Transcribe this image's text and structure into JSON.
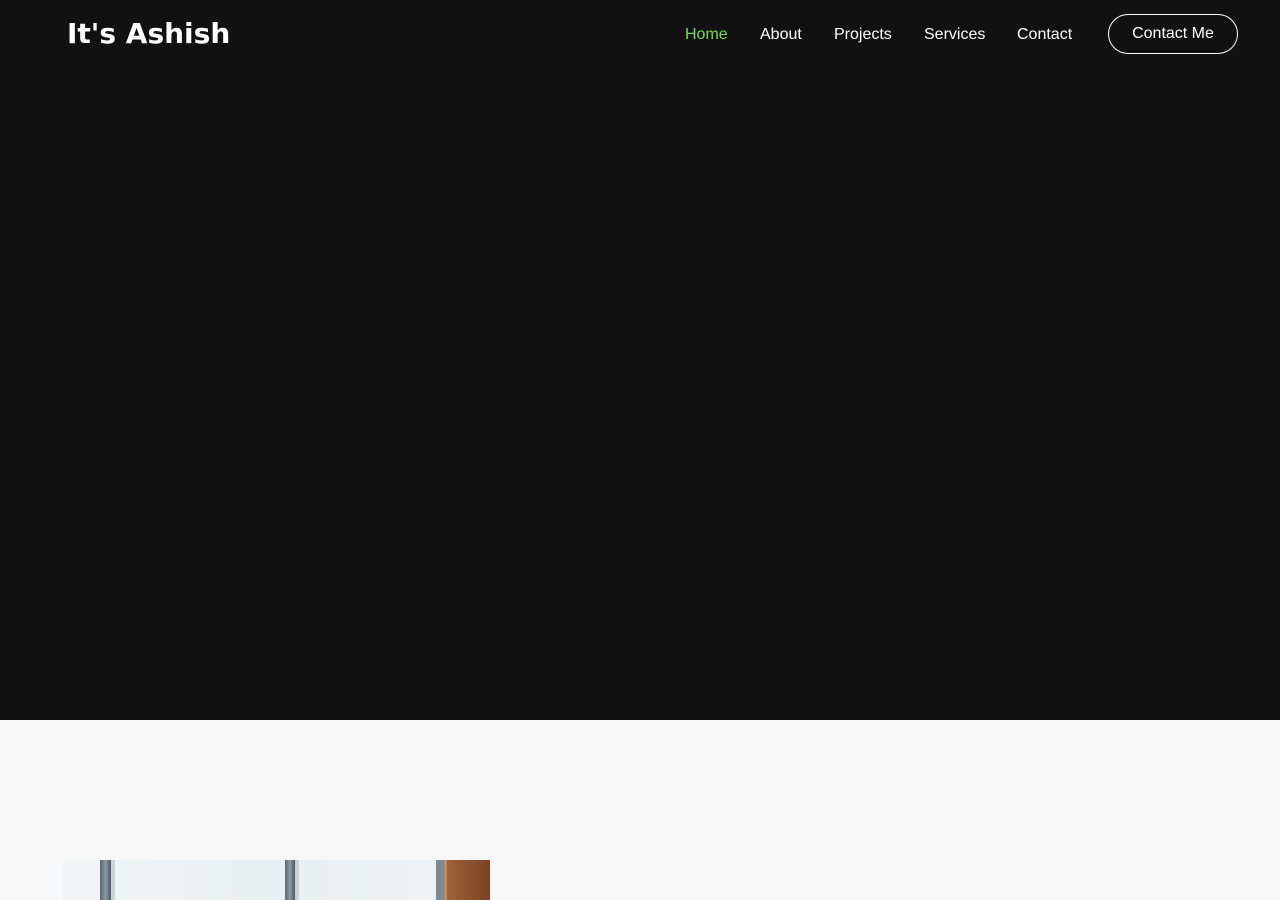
{
  "brand": {
    "name": "It's Ashish"
  },
  "nav": {
    "items": [
      {
        "label": "Home",
        "active": true
      },
      {
        "label": "About",
        "active": false
      },
      {
        "label": "Projects",
        "active": false
      },
      {
        "label": "Services",
        "active": false
      },
      {
        "label": "Contact",
        "active": false
      }
    ],
    "cta_label": "Contact Me"
  },
  "colors": {
    "hero_background": "#111111",
    "section_background": "#f7f7f7",
    "accent": "#7ed957",
    "text": "#ffffff"
  }
}
